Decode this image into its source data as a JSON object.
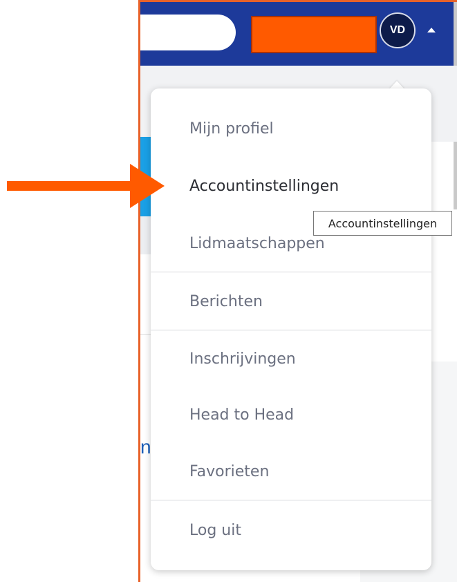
{
  "header": {
    "avatar_initials": "VD",
    "colors": {
      "bar": "#1d3a9a",
      "redaction": "#ff5a00"
    }
  },
  "menu": {
    "items": [
      {
        "label": "Mijn profiel"
      },
      {
        "label": "Accountinstellingen",
        "active": true
      },
      {
        "label": "Lidmaatschappen"
      },
      {
        "label": "Berichten"
      },
      {
        "label": "Inschrijvingen"
      },
      {
        "label": "Head to Head"
      },
      {
        "label": "Favorieten"
      },
      {
        "label": "Log uit"
      }
    ]
  },
  "tooltip": {
    "text": "Accountinstellingen"
  },
  "background": {
    "partial_letter": "n"
  },
  "annotation": {
    "arrow_color": "#ff5a00"
  }
}
